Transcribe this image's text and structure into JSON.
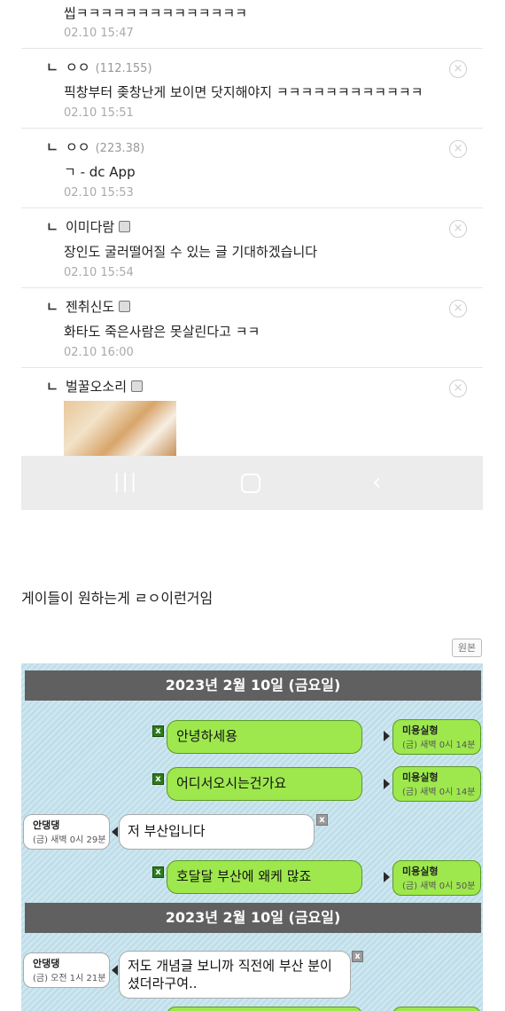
{
  "comments": [
    {
      "name": "",
      "ip": "",
      "gallog": false,
      "text": "씹ㅋㅋㅋㅋㅋㅋㅋㅋㅋㅋㅋㅋㅋㅋ",
      "time": "02.10 15:47"
    },
    {
      "name": "ㅇㅇ",
      "ip": "(112.155)",
      "gallog": false,
      "text": "픽창부터 좆창난게 보이면 닷지해야지 ㅋㅋㅋㅋㅋㅋㅋㅋㅋㅋㅋㅋ",
      "time": "02.10 15:51"
    },
    {
      "name": "ㅇㅇ",
      "ip": "(223.38)",
      "gallog": false,
      "text": "ㄱ - dc App",
      "time": "02.10 15:53"
    },
    {
      "name": "이미다람",
      "ip": "",
      "gallog": true,
      "text": "장인도 굴러떨어질 수 있는 글 기대하겠습니다",
      "time": "02.10 15:54"
    },
    {
      "name": "젠취신도",
      "ip": "",
      "gallog": true,
      "text": "화타도 죽은사람은 못살린다고 ㅋㅋ",
      "time": "02.10 16:00"
    },
    {
      "name": "벌꿀오소리",
      "ip": "",
      "gallog": true,
      "text": "",
      "time": ""
    }
  ],
  "reply_mark": "ㄴ",
  "delete_symbol": "×",
  "android_nav": {
    "recent": "|||",
    "home": "",
    "back": "‹"
  },
  "caption": "게이들이 원하는게 ㄹㅇ이런거임",
  "original_button": "원본",
  "chat": {
    "date_bar_1": "2023년 2월 10일 (금요일)",
    "date_bar_2": "2023년 2월 10일 (금요일)",
    "x_mark": "x",
    "messages": [
      {
        "side": "sent",
        "text": "안녕하세용",
        "nick": "미용실형",
        "time": "(금) 새벽 0시 14분"
      },
      {
        "side": "sent",
        "text": "어디서오시는건가요",
        "nick": "미용실형",
        "time": "(금) 새벽 0시 14분"
      },
      {
        "side": "recv",
        "text": "저 부산입니다",
        "nick": "안댕댕",
        "time": "(금) 새벽 0시 29분"
      },
      {
        "side": "sent",
        "text": "호달달 부산에 왜케 많죠",
        "nick": "미용실형",
        "time": "(금) 새벽 0시 50분"
      },
      {
        "side": "recv",
        "text_line1": "저도 개념글 보니까 직전에 부산 분이",
        "text_line2": "셨더라구여..",
        "nick": "안댕댕",
        "time": "(금) 오전 1시 21분"
      }
    ]
  },
  "colors": {
    "sent_bubble": "#9ee84e",
    "date_bar": "#606060",
    "chat_background": "#cde6ef",
    "nav_bar": "#ececec"
  }
}
